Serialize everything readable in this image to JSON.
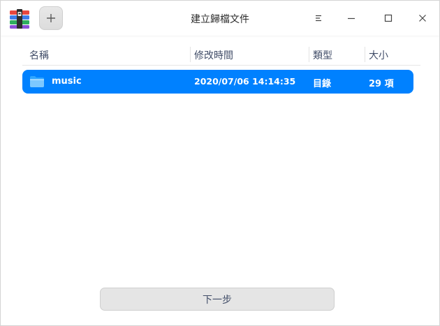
{
  "window": {
    "title": "建立歸檔文件",
    "app_icon": "archive-manager-icon",
    "add_button_icon": "plus-icon",
    "controls": [
      "menu-icon",
      "minimize-icon",
      "maximize-icon",
      "close-icon"
    ]
  },
  "table": {
    "columns": [
      "名稱",
      "修改時間",
      "類型",
      "大小"
    ],
    "rows": [
      {
        "icon": "folder-icon",
        "name": "music",
        "modified": "2020/07/06 14:14:35",
        "type": "目錄",
        "size": "29 項",
        "selected": true
      }
    ]
  },
  "footer": {
    "next_label": "下一步"
  },
  "colors": {
    "accent": "#0081ff",
    "background": "#ffffff",
    "text": "#414d68"
  }
}
